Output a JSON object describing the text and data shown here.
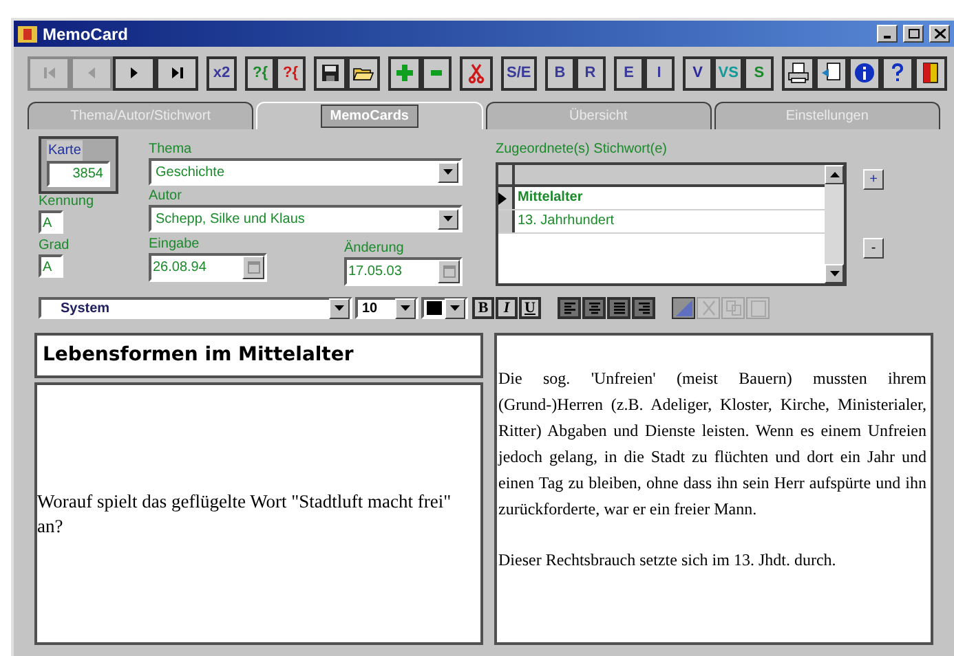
{
  "window": {
    "title": "MemoCard"
  },
  "toolbar": {
    "groups": [
      [
        {
          "kind": "icon",
          "disabled": true
        },
        {
          "kind": "icon",
          "disabled": true
        },
        {
          "kind": "icon",
          "disabled": false
        },
        {
          "kind": "icon",
          "disabled": false
        }
      ],
      [
        {
          "kind": "text",
          "label": "x2",
          "color": "#3a3a9a",
          "disabled": false
        }
      ],
      [
        {
          "kind": "text",
          "label": "?{",
          "color": "#1a8a2a",
          "disabled": false
        },
        {
          "kind": "text",
          "label": "?{",
          "color": "#d01818",
          "disabled": false
        }
      ],
      [
        {
          "kind": "icon",
          "disabled": false
        },
        {
          "kind": "icon",
          "disabled": false
        }
      ],
      [
        {
          "kind": "icon",
          "disabled": false
        },
        {
          "kind": "icon",
          "disabled": false
        }
      ],
      [
        {
          "kind": "icon",
          "disabled": false
        }
      ],
      [
        {
          "kind": "text",
          "label": "S/E",
          "color": "#3a3a9a",
          "disabled": false
        }
      ],
      [
        {
          "kind": "text",
          "label": "B",
          "color": "#3a3a9a",
          "disabled": false
        },
        {
          "kind": "text",
          "label": "R",
          "color": "#3a3a9a",
          "disabled": false
        }
      ],
      [
        {
          "kind": "text",
          "label": "E",
          "color": "#3a3a9a",
          "disabled": false
        },
        {
          "kind": "text",
          "label": "I",
          "color": "#3a3a9a",
          "disabled": false
        }
      ],
      [
        {
          "kind": "text",
          "label": "V",
          "color": "#2a2a9a",
          "disabled": false
        },
        {
          "kind": "text",
          "label": "VS",
          "color": "#109a9a",
          "disabled": false
        },
        {
          "kind": "text",
          "label": "S",
          "color": "#1a8a2a",
          "disabled": false
        }
      ],
      [
        {
          "kind": "icon",
          "disabled": false
        },
        {
          "kind": "icon",
          "disabled": false
        },
        {
          "kind": "icon",
          "disabled": false
        },
        {
          "kind": "icon",
          "disabled": false
        },
        {
          "kind": "icon",
          "disabled": false
        }
      ]
    ]
  },
  "tabs": [
    {
      "label": "Thema/Autor/Stichwort",
      "selected": false
    },
    {
      "label": "MemoCards",
      "selected": true
    },
    {
      "label": "Übersicht",
      "selected": false
    },
    {
      "label": "Einstellungen",
      "selected": false
    }
  ],
  "card": {
    "label": "Karte",
    "value": "3854"
  },
  "fields": {
    "thema": {
      "label": "Thema",
      "value": "Geschichte"
    },
    "kennung": {
      "label": "Kennung",
      "value": "A"
    },
    "autor": {
      "label": "Autor",
      "value": "Schepp, Silke und Klaus"
    },
    "grad": {
      "label": "Grad",
      "value": "A"
    },
    "eingabe": {
      "label": "Eingabe",
      "value": "26.08.94"
    },
    "aenderung": {
      "label": "Änderung",
      "value": "17.05.03"
    }
  },
  "keywords": {
    "label": "Zugeordnete(s) Stichwort(e)",
    "rows": [
      {
        "text": "Mittelalter",
        "selected": true
      },
      {
        "text": "13. Jahrhundert",
        "selected": false
      }
    ],
    "add_button": "+",
    "remove_button": "-"
  },
  "format_bar": {
    "font": "System",
    "size": "10",
    "styles": [
      {
        "label": "B",
        "kind": "bold"
      },
      {
        "label": "I",
        "kind": "italic"
      },
      {
        "label": "U",
        "kind": "underline"
      }
    ],
    "tools": [
      {
        "disabled": false
      },
      {
        "disabled": true
      },
      {
        "disabled": true
      },
      {
        "disabled": true
      }
    ]
  },
  "question": {
    "title": "Lebensformen im Mittelalter",
    "text": "Worauf spielt das geflügelte Wort \"Stadtluft macht frei\" an?"
  },
  "answer": {
    "paragraphs": [
      "Die sog. 'Unfreien' (meist Bauern) mussten ihrem (Grund-)Herren (z.B. Adeliger, Kloster, Kirche, Ministerialer, Ritter) Abgaben und Dienste leisten. Wenn es einem Unfreien jedoch gelang, in die Stadt zu flüchten und dort ein Jahr und einen Tag zu bleiben, ohne dass ihn sein Herr aufspürte und ihn zurückforderte, war er ein freier Mann.",
      "Dieser Rechtsbrauch setzte sich im 13. Jhdt. durch."
    ]
  }
}
